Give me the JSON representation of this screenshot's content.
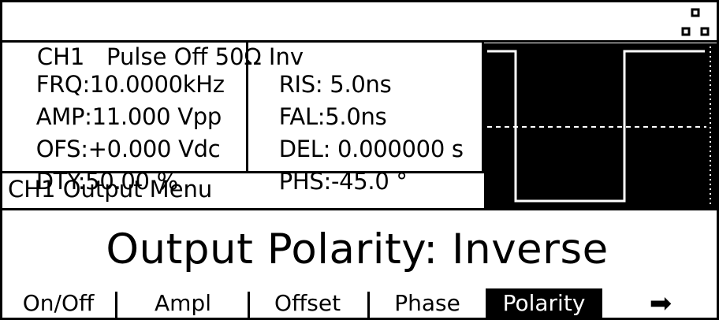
{
  "status_bar": {
    "channel": "CH1",
    "mode_text": "Pulse Off 50Ω Inv",
    "icon": "channel-pattern-icon"
  },
  "params_left": [
    {
      "label": "FRQ:",
      "value": "10.0000kHz"
    },
    {
      "label": "AMP:",
      "value": "11.000 Vpp"
    },
    {
      "label": "OFS:",
      "value": "+0.000 Vdc"
    },
    {
      "label": "DTY:",
      "value": "50.00 %"
    }
  ],
  "params_right": [
    {
      "label": "RIS:",
      "value": " 5.0ns"
    },
    {
      "label": "FAL:",
      "value": "5.0ns"
    },
    {
      "label": "DEL:",
      "value": " 0.000000 s"
    },
    {
      "label": "PHS:",
      "value": "-45.0 °"
    }
  ],
  "menu": {
    "title": "CH1 Output Menu",
    "message": "Output Polarity: Inverse"
  },
  "waveform": {
    "type": "inverted-square-wave",
    "duty_percent": 50
  },
  "softkeys": [
    {
      "label": "On/Off",
      "active": false
    },
    {
      "label": "Ampl",
      "active": false
    },
    {
      "label": "Offset",
      "active": false
    },
    {
      "label": "Phase",
      "active": false
    },
    {
      "label": "Polarity",
      "active": true
    },
    {
      "label": "➡",
      "active": false,
      "icon": "next-arrow-icon"
    }
  ],
  "colors": {
    "foreground": "#000000",
    "background": "#ffffff"
  }
}
